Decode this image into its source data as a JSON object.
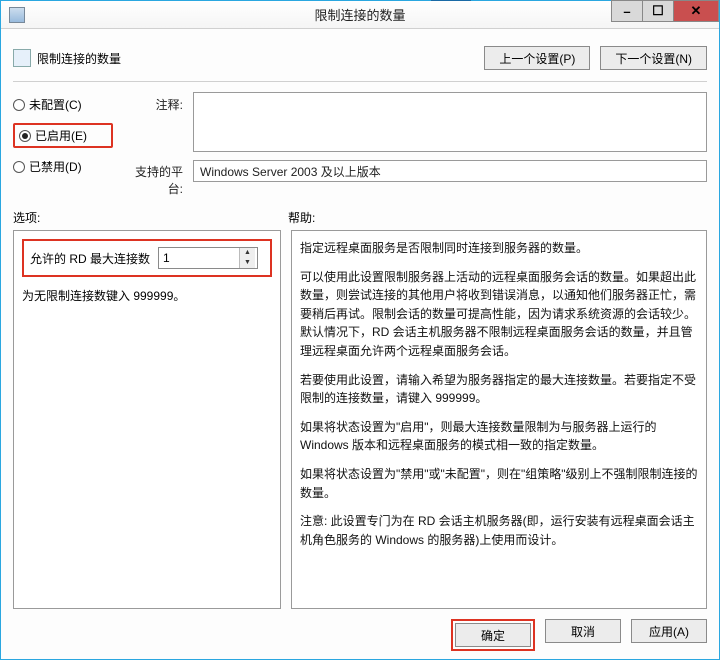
{
  "window": {
    "title": "限制连接的数量"
  },
  "header": {
    "section_title": "限制连接的数量",
    "prev_setting_label": "上一个设置(P)",
    "next_setting_label": "下一个设置(N)"
  },
  "state": {
    "not_configured_label": "未配置(C)",
    "enabled_label": "已启用(E)",
    "disabled_label": "已禁用(D)",
    "selected": "enabled"
  },
  "fields": {
    "comment_label": "注释:",
    "comment_value": "",
    "supported_label": "支持的平台:",
    "supported_value": "Windows Server 2003 及以上版本"
  },
  "columns": {
    "options_label": "选项:",
    "help_label": "帮助:"
  },
  "options": {
    "max_conn_label": "允许的 RD 最大连接数",
    "max_conn_value": "1",
    "unlimited_hint": "为无限制连接数键入 999999。"
  },
  "help": {
    "p1": "指定远程桌面服务是否限制同时连接到服务器的数量。",
    "p2": "可以使用此设置限制服务器上活动的远程桌面服务会话的数量。如果超出此数量，则尝试连接的其他用户将收到错误消息，以通知他们服务器正忙，需要稍后再试。限制会话的数量可提高性能，因为请求系统资源的会话较少。默认情况下，RD 会话主机服务器不限制远程桌面服务会话的数量，并且管理远程桌面允许两个远程桌面服务会话。",
    "p3": "若要使用此设置，请输入希望为服务器指定的最大连接数量。若要指定不受限制的连接数量，请键入 999999。",
    "p4": "如果将状态设置为\"启用\"，则最大连接数量限制为与服务器上运行的 Windows 版本和远程桌面服务的模式相一致的指定数量。",
    "p5": "如果将状态设置为\"禁用\"或\"未配置\"，则在\"组策略\"级别上不强制限制连接的数量。",
    "p6": "注意: 此设置专门为在 RD 会话主机服务器(即，运行安装有远程桌面会话主机角色服务的 Windows 的服务器)上使用而设计。"
  },
  "footer": {
    "ok_label": "确定",
    "cancel_label": "取消",
    "apply_label": "应用(A)"
  },
  "icons": {
    "app": "policy-icon",
    "min": "–",
    "max": "☐",
    "close": "✕"
  }
}
